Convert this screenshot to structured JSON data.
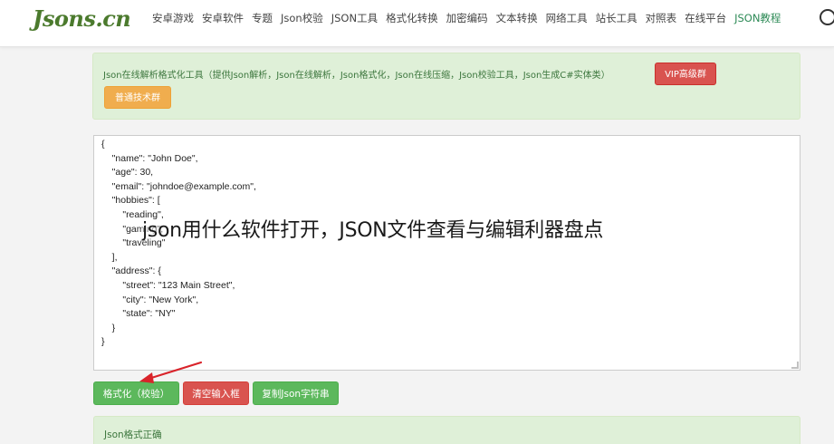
{
  "header": {
    "logo": "Jsons.cn",
    "nav": [
      {
        "label": "安卓游戏",
        "active": false
      },
      {
        "label": "安卓软件",
        "active": false
      },
      {
        "label": "专题",
        "active": false
      },
      {
        "label": "Json校验",
        "active": false
      },
      {
        "label": "JSON工具",
        "active": false
      },
      {
        "label": "格式化转换",
        "active": false
      },
      {
        "label": "加密编码",
        "active": false
      },
      {
        "label": "文本转换",
        "active": false
      },
      {
        "label": "网络工具",
        "active": false
      },
      {
        "label": "站长工具",
        "active": false
      },
      {
        "label": "对照表",
        "active": false
      },
      {
        "label": "在线平台",
        "active": false
      },
      {
        "label": "JSON教程",
        "active": true
      }
    ]
  },
  "info_alert": {
    "text": "Json在线解析格式化工具（提供Json解析，Json在线解析，Json格式化，Json在线压缩，Json校验工具，Json生成C#实体类）",
    "vip_button": "VIP高级群",
    "group_button": "普通技术群"
  },
  "editor": {
    "content": "{\n    \"name\": \"John Doe\",\n    \"age\": 30,\n    \"email\": \"johndoe@example.com\",\n    \"hobbies\": [\n        \"reading\",\n        \"gaming\",\n        \"traveling\"\n    ],\n    \"address\": {\n        \"street\": \"123 Main Street\",\n        \"city\": \"New York\",\n        \"state\": \"NY\"\n    }\n}"
  },
  "overlay_caption": "json用什么软件打开，JSON文件查看与编辑利器盘点",
  "actions": {
    "format": "格式化（校验）",
    "clear": "清空输入框",
    "copy": "复制Json字符串"
  },
  "result": {
    "text": "Json格式正确"
  },
  "colors": {
    "brand_green": "#4b7a2d",
    "success_bg": "#dff0d8",
    "success_text": "#3c763d",
    "danger": "#d9534f",
    "warning": "#f0ad4e",
    "success_btn": "#5cb85c",
    "arrow": "#d9232a"
  }
}
